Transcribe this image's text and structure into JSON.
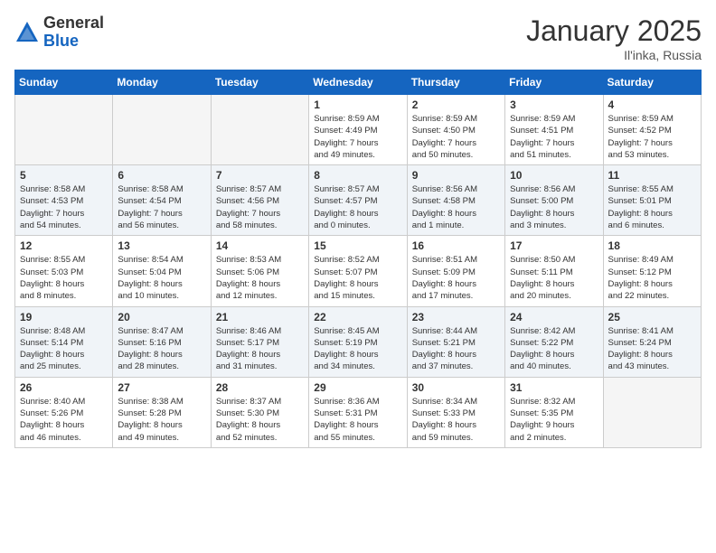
{
  "header": {
    "logo_general": "General",
    "logo_blue": "Blue",
    "month_title": "January 2025",
    "location": "Il'inka, Russia"
  },
  "weekdays": [
    "Sunday",
    "Monday",
    "Tuesday",
    "Wednesday",
    "Thursday",
    "Friday",
    "Saturday"
  ],
  "weeks": [
    [
      {
        "day": "",
        "info": ""
      },
      {
        "day": "",
        "info": ""
      },
      {
        "day": "",
        "info": ""
      },
      {
        "day": "1",
        "info": "Sunrise: 8:59 AM\nSunset: 4:49 PM\nDaylight: 7 hours\nand 49 minutes."
      },
      {
        "day": "2",
        "info": "Sunrise: 8:59 AM\nSunset: 4:50 PM\nDaylight: 7 hours\nand 50 minutes."
      },
      {
        "day": "3",
        "info": "Sunrise: 8:59 AM\nSunset: 4:51 PM\nDaylight: 7 hours\nand 51 minutes."
      },
      {
        "day": "4",
        "info": "Sunrise: 8:59 AM\nSunset: 4:52 PM\nDaylight: 7 hours\nand 53 minutes."
      }
    ],
    [
      {
        "day": "5",
        "info": "Sunrise: 8:58 AM\nSunset: 4:53 PM\nDaylight: 7 hours\nand 54 minutes."
      },
      {
        "day": "6",
        "info": "Sunrise: 8:58 AM\nSunset: 4:54 PM\nDaylight: 7 hours\nand 56 minutes."
      },
      {
        "day": "7",
        "info": "Sunrise: 8:57 AM\nSunset: 4:56 PM\nDaylight: 7 hours\nand 58 minutes."
      },
      {
        "day": "8",
        "info": "Sunrise: 8:57 AM\nSunset: 4:57 PM\nDaylight: 8 hours\nand 0 minutes."
      },
      {
        "day": "9",
        "info": "Sunrise: 8:56 AM\nSunset: 4:58 PM\nDaylight: 8 hours\nand 1 minute."
      },
      {
        "day": "10",
        "info": "Sunrise: 8:56 AM\nSunset: 5:00 PM\nDaylight: 8 hours\nand 3 minutes."
      },
      {
        "day": "11",
        "info": "Sunrise: 8:55 AM\nSunset: 5:01 PM\nDaylight: 8 hours\nand 6 minutes."
      }
    ],
    [
      {
        "day": "12",
        "info": "Sunrise: 8:55 AM\nSunset: 5:03 PM\nDaylight: 8 hours\nand 8 minutes."
      },
      {
        "day": "13",
        "info": "Sunrise: 8:54 AM\nSunset: 5:04 PM\nDaylight: 8 hours\nand 10 minutes."
      },
      {
        "day": "14",
        "info": "Sunrise: 8:53 AM\nSunset: 5:06 PM\nDaylight: 8 hours\nand 12 minutes."
      },
      {
        "day": "15",
        "info": "Sunrise: 8:52 AM\nSunset: 5:07 PM\nDaylight: 8 hours\nand 15 minutes."
      },
      {
        "day": "16",
        "info": "Sunrise: 8:51 AM\nSunset: 5:09 PM\nDaylight: 8 hours\nand 17 minutes."
      },
      {
        "day": "17",
        "info": "Sunrise: 8:50 AM\nSunset: 5:11 PM\nDaylight: 8 hours\nand 20 minutes."
      },
      {
        "day": "18",
        "info": "Sunrise: 8:49 AM\nSunset: 5:12 PM\nDaylight: 8 hours\nand 22 minutes."
      }
    ],
    [
      {
        "day": "19",
        "info": "Sunrise: 8:48 AM\nSunset: 5:14 PM\nDaylight: 8 hours\nand 25 minutes."
      },
      {
        "day": "20",
        "info": "Sunrise: 8:47 AM\nSunset: 5:16 PM\nDaylight: 8 hours\nand 28 minutes."
      },
      {
        "day": "21",
        "info": "Sunrise: 8:46 AM\nSunset: 5:17 PM\nDaylight: 8 hours\nand 31 minutes."
      },
      {
        "day": "22",
        "info": "Sunrise: 8:45 AM\nSunset: 5:19 PM\nDaylight: 8 hours\nand 34 minutes."
      },
      {
        "day": "23",
        "info": "Sunrise: 8:44 AM\nSunset: 5:21 PM\nDaylight: 8 hours\nand 37 minutes."
      },
      {
        "day": "24",
        "info": "Sunrise: 8:42 AM\nSunset: 5:22 PM\nDaylight: 8 hours\nand 40 minutes."
      },
      {
        "day": "25",
        "info": "Sunrise: 8:41 AM\nSunset: 5:24 PM\nDaylight: 8 hours\nand 43 minutes."
      }
    ],
    [
      {
        "day": "26",
        "info": "Sunrise: 8:40 AM\nSunset: 5:26 PM\nDaylight: 8 hours\nand 46 minutes."
      },
      {
        "day": "27",
        "info": "Sunrise: 8:38 AM\nSunset: 5:28 PM\nDaylight: 8 hours\nand 49 minutes."
      },
      {
        "day": "28",
        "info": "Sunrise: 8:37 AM\nSunset: 5:30 PM\nDaylight: 8 hours\nand 52 minutes."
      },
      {
        "day": "29",
        "info": "Sunrise: 8:36 AM\nSunset: 5:31 PM\nDaylight: 8 hours\nand 55 minutes."
      },
      {
        "day": "30",
        "info": "Sunrise: 8:34 AM\nSunset: 5:33 PM\nDaylight: 8 hours\nand 59 minutes."
      },
      {
        "day": "31",
        "info": "Sunrise: 8:32 AM\nSunset: 5:35 PM\nDaylight: 9 hours\nand 2 minutes."
      },
      {
        "day": "",
        "info": ""
      }
    ]
  ]
}
